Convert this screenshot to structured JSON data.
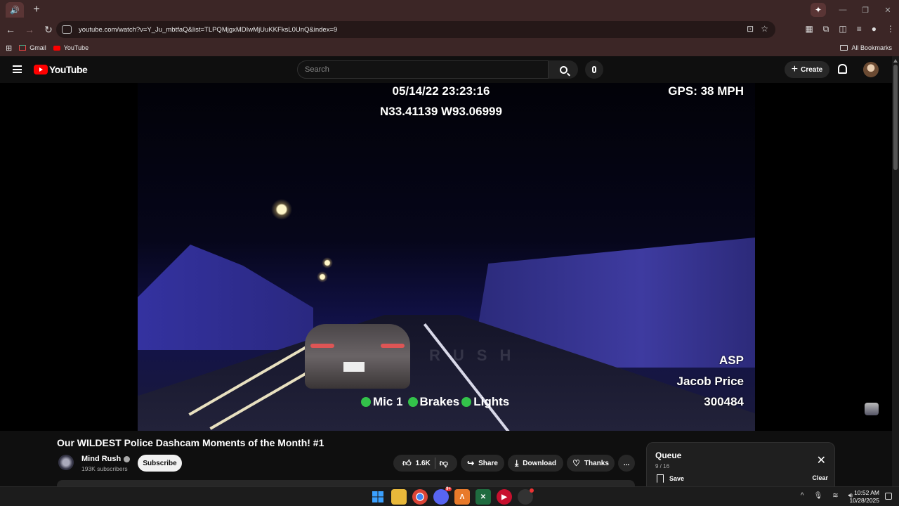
{
  "browser": {
    "url": "youtube.com/watch?v=Y_Ju_mbtfaQ&list=TLPQMjgxMDIwMjUuKKFksL0UnQ&index=9",
    "bookmarks": [
      {
        "label": "Gmail",
        "icon": "gmail-icon"
      },
      {
        "label": "YouTube",
        "icon": "youtube-icon"
      }
    ],
    "all_bookmarks_label": "All Bookmarks"
  },
  "youtube_header": {
    "logo_text": "YouTube",
    "search_placeholder": "Search",
    "create_label": "Create"
  },
  "video": {
    "overlay": {
      "datetime": "05/14/22 23:23:16",
      "coordinates": "N33.41139 W93.06999",
      "gps_speed": "GPS: 38 MPH",
      "agency": "ASP",
      "officer": "Jacob Price",
      "unit_id": "300484",
      "indicators": [
        "Mic 1",
        "Brakes",
        "Lights"
      ],
      "watermark": "RUSH"
    },
    "title": "Our WILDEST Police Dashcam Moments of the Month! #1",
    "channel": {
      "name": "Mind Rush",
      "subscribers": "193K subscribers",
      "avatar_text": "RUSH"
    },
    "subscribe_label": "Subscribe",
    "actions": {
      "likes": "1.6K",
      "share": "Share",
      "download": "Download",
      "thanks": "Thanks",
      "more": "..."
    }
  },
  "queue": {
    "title": "Queue",
    "position": "9 / 16",
    "save_label": "Save",
    "clear_label": "Clear"
  },
  "taskbar": {
    "time": "10:52 AM",
    "date": "10/28/2025",
    "discord_badge": "9+"
  },
  "colors": {
    "browser_chrome": "#3c2626",
    "youtube_red": "#ff0000",
    "page_bg": "#0f0f0f",
    "indicator_green": "#33c24a"
  }
}
